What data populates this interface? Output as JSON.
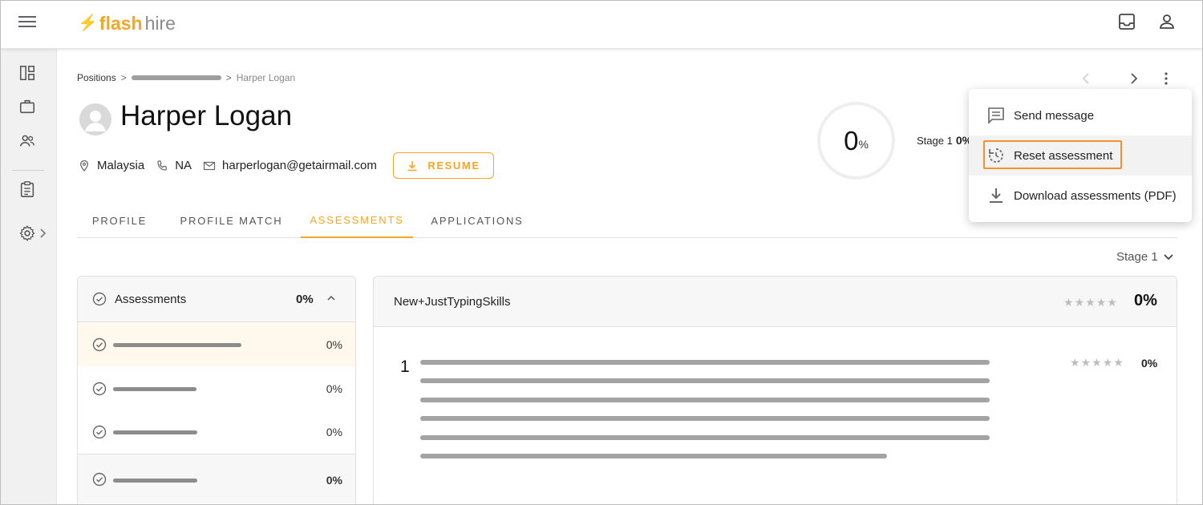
{
  "app": {
    "logo_main": "flash",
    "logo_sub": "hire",
    "accent": "#f5a623"
  },
  "topbar_icons": [
    "menu-icon",
    "inbox-icon",
    "account-icon"
  ],
  "sidebar": {
    "items": [
      "dashboard-icon",
      "briefcase-icon",
      "people-icon",
      "clipboard-icon",
      "settings-icon",
      "chevron-right-icon"
    ]
  },
  "breadcrumb": {
    "root": "Positions",
    "sep1": ">",
    "sep2": ">",
    "current": "Harper Logan"
  },
  "candidate": {
    "name": "Harper Logan",
    "location": "Malaysia",
    "phone": "NA",
    "email": "harperlogan@getairmail.com",
    "resume_label": "RESUME"
  },
  "score": {
    "value": "0",
    "unit": "%",
    "stage_label": "Stage 1",
    "stage_value": "0%"
  },
  "tabs": [
    {
      "label": "PROFILE",
      "active": false
    },
    {
      "label": "PROFILE MATCH",
      "active": false
    },
    {
      "label": "ASSESSMENTS",
      "active": true
    },
    {
      "label": "APPLICATIONS",
      "active": false
    }
  ],
  "stage_select": {
    "value": "Stage 1"
  },
  "assessments_panel": {
    "title": "Assessments",
    "total": "0%",
    "rows": [
      {
        "pct": "0%",
        "selected": true
      },
      {
        "pct": "0%",
        "selected": false
      },
      {
        "pct": "0%",
        "selected": false
      },
      {
        "pct": "0%",
        "selected": false
      }
    ]
  },
  "detail": {
    "title": "New+JustTypingSkills",
    "score": "0%",
    "question": {
      "number": "1",
      "score": "0%"
    }
  },
  "menu": {
    "items": [
      {
        "label": "Send message",
        "icon": "message-icon"
      },
      {
        "label": "Reset assessment",
        "icon": "reset-icon"
      },
      {
        "label": "Download assessments (PDF)",
        "icon": "download-icon"
      }
    ]
  }
}
